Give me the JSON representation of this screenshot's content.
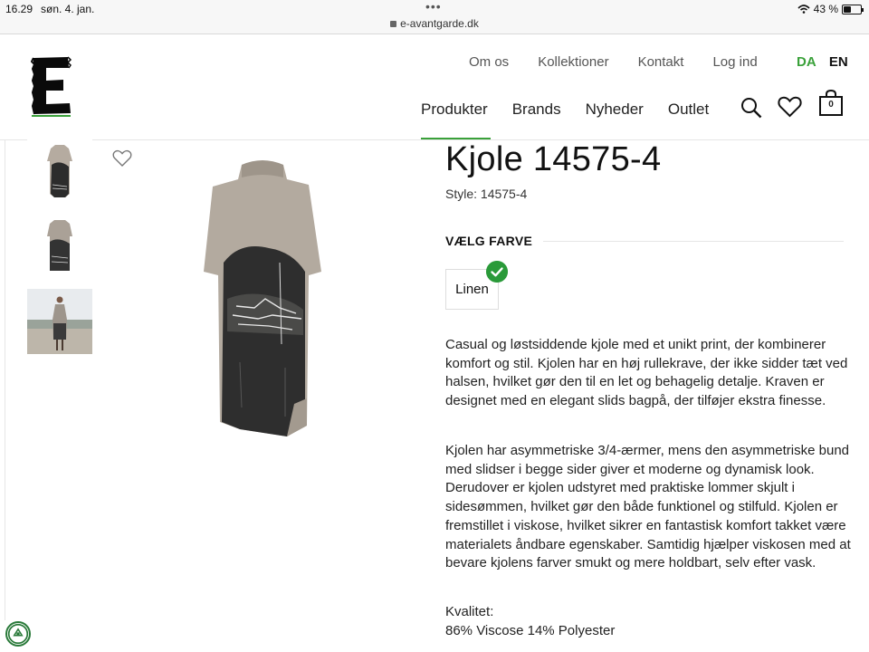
{
  "status_bar": {
    "time": "16.29",
    "date": "søn. 4. jan.",
    "url": "e-avantgarde.dk",
    "battery": "43 %",
    "battery_level": 0.43
  },
  "header": {
    "top_nav": [
      "Om os",
      "Kollektioner",
      "Kontakt",
      "Log ind"
    ],
    "languages": {
      "da": "DA",
      "en": "EN",
      "active": "DA"
    },
    "main_nav": [
      "Produkter",
      "Brands",
      "Nyheder",
      "Outlet"
    ],
    "active_main_nav": "Produkter",
    "cart_count": "0",
    "accent_color": "#3aa13a"
  },
  "product": {
    "title": "Kjole 14575-4",
    "style": "Style: 14575-4",
    "color_heading": "VÆLG FARVE",
    "color_option": "Linen",
    "description_1": "Casual og løstsiddende kjole med et unikt print, der kombinerer komfort og stil. Kjolen har en høj rullekrave, der ikke sidder tæt ved halsen, hvilket gør den til en let og behagelig detalje. Kraven er designet med en elegant slids bagpå, der tilføjer ekstra finesse.",
    "description_2": "Kjolen har asymmetriske 3/4-ærmer, mens den asymmetriske bund med slidser i begge sider giver et moderne og dynamisk look. Derudover er kjolen udstyret med praktiske lommer skjult i sidesømmen, hvilket gør den både funktionel og stilfuld. Kjolen er fremstillet i viskose, hvilket sikrer en fantastisk komfort takket være materialets åndbare egenskaber. Samtidig hjælper viskosen med at bevare kjolens farver smukt og mere holdbart, selv efter vask.",
    "quality_label": "Kvalitet:",
    "quality_value": "86% Viscose 14% Polyester"
  },
  "icons": [
    "lock-icon",
    "wifi-icon",
    "battery-icon",
    "search-icon",
    "heart-icon",
    "cart-icon",
    "favorite-icon",
    "check-icon",
    "recycle-badge-icon"
  ]
}
